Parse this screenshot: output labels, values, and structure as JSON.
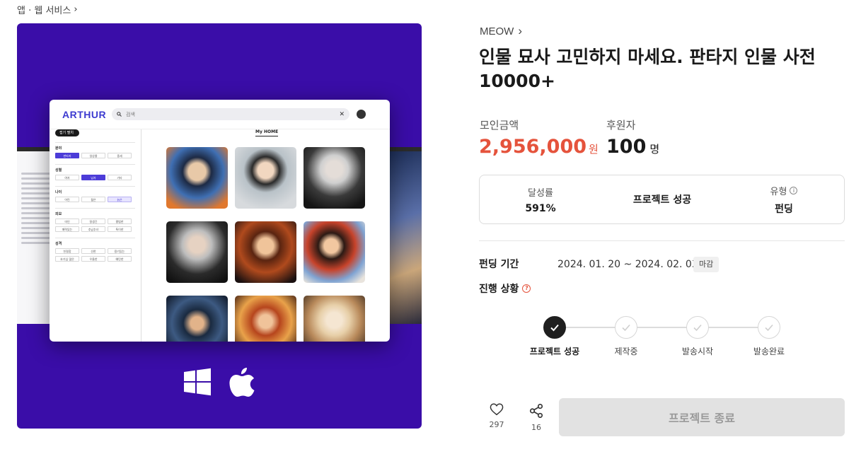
{
  "breadcrumb": {
    "label": "앱 · 웹 서비스"
  },
  "hero": {
    "app_logo": "ARTHUR",
    "search_placeholder": "검색",
    "tab": "My HOME",
    "sidebar": {
      "toggle": "접기 펼치",
      "groups": [
        {
          "title": "분야",
          "chips": [
            "판타지",
            "일상물",
            "중세"
          ],
          "selected": 0
        },
        {
          "title": "성별",
          "chips": [
            "여자",
            "남자",
            "기타"
          ],
          "selected": 1
        },
        {
          "title": "나이",
          "chips": [
            "어린",
            "젊은",
            "늙은"
          ],
          "selected": 2
        },
        {
          "title": "외모",
          "chips": [
            "미인",
            "잘생긴",
            "평범한",
            "매력있는",
            "추남추녀",
            "특이한"
          ],
          "selected": -1
        },
        {
          "title": "성격",
          "chips": [
            "친절함",
            "선한",
            "용기있는",
            "호기심 많은",
            "우울한",
            "예민한"
          ],
          "selected": -1
        }
      ]
    },
    "os_icons": [
      "windows-icon",
      "apple-icon"
    ]
  },
  "project": {
    "creator": "MEOW",
    "title": "인물 묘사 고민하지 마세요. 판타지 인물 사전 10000+",
    "raised_label": "모인금액",
    "raised_value": "2,956,000",
    "raised_unit": "원",
    "backers_label": "후원자",
    "backers_value": "100",
    "backers_unit": "명",
    "status": {
      "achievement_label": "달성률",
      "achievement_value": "591%",
      "result": "프로젝트 성공",
      "type_label": "유형",
      "type_value": "펀딩"
    },
    "period_label": "펀딩 기간",
    "period_value": "2024. 01. 20 ~ 2024. 02. 03",
    "period_badge": "마감",
    "progress_label": "진행 상황",
    "steps": [
      {
        "label": "프로젝트 성공",
        "done": true
      },
      {
        "label": "제작중",
        "done": false
      },
      {
        "label": "발송시작",
        "done": false
      },
      {
        "label": "발송완료",
        "done": false
      }
    ]
  },
  "actions": {
    "likes": "297",
    "shares": "16",
    "end_button": "프로젝트 종료"
  },
  "colors": {
    "hero_bg": "#3a0da8",
    "accent_red": "#e5533c",
    "logo_blue": "#3d3bd0"
  }
}
